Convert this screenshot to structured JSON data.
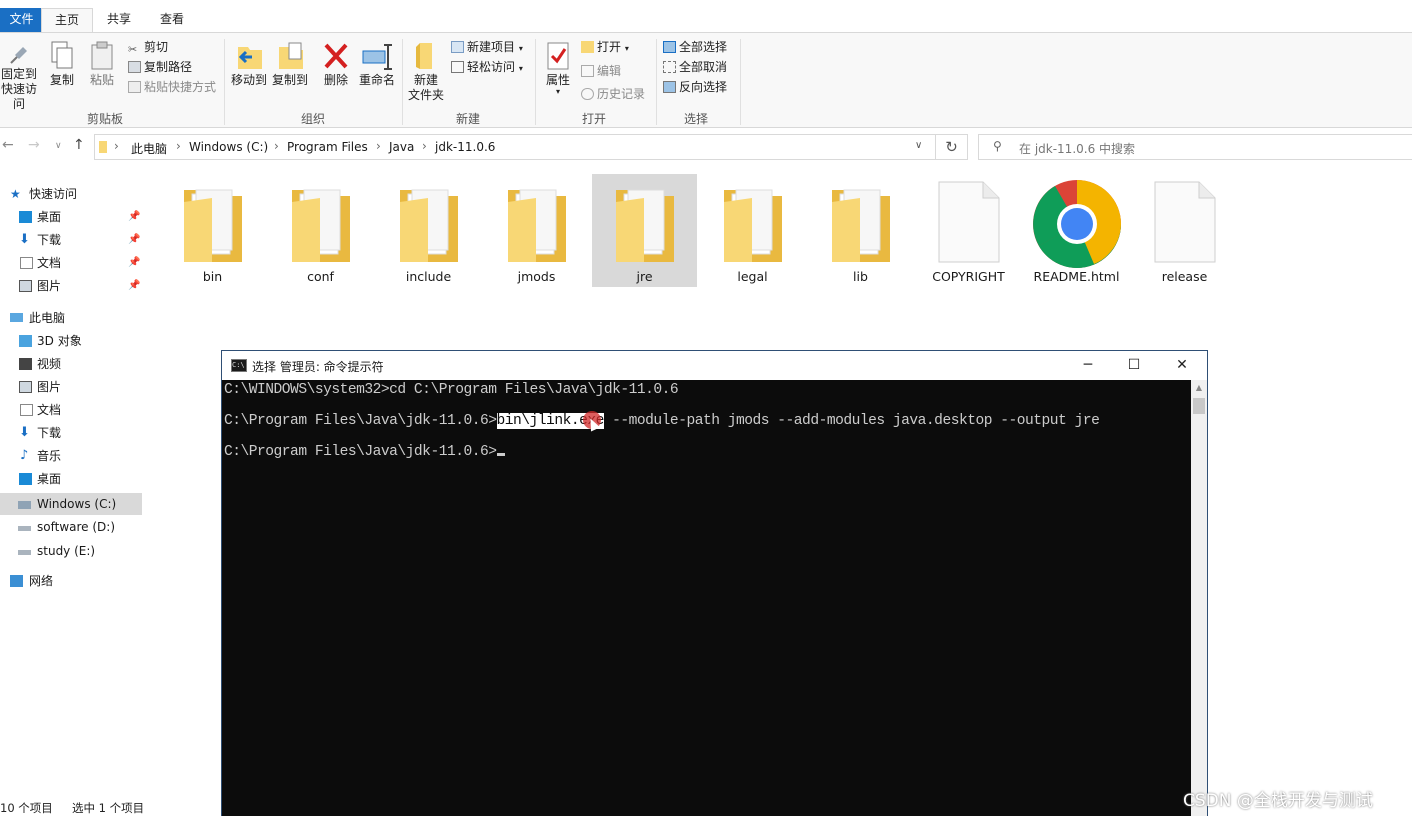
{
  "ribbon_tabs": {
    "file": "文件",
    "home": "主页",
    "share": "共享",
    "view": "查看"
  },
  "clipboard": {
    "pin": "固定到\n快速访问",
    "copy": "复制",
    "paste": "粘贴",
    "cut": "剪切",
    "copy_path": "复制路径",
    "paste_shortcut": "粘贴快捷方式",
    "label": "剪贴板"
  },
  "organize": {
    "move_to": "移动到",
    "copy_to": "复制到",
    "delete": "删除",
    "rename": "重命名",
    "label": "组织"
  },
  "new_group": {
    "new_folder": "新建\n文件夹",
    "new_item": "新建项目",
    "easy_access": "轻松访问",
    "label": "新建"
  },
  "open_group": {
    "properties": "属性",
    "open": "打开",
    "edit": "编辑",
    "history": "历史记录",
    "label": "打开"
  },
  "select_group": {
    "select_all": "全部选择",
    "select_none": "全部取消",
    "invert": "反向选择",
    "label": "选择"
  },
  "address": {
    "crumbs": [
      "此电脑",
      "Windows (C:)",
      "Program Files",
      "Java",
      "jdk-11.0.6"
    ],
    "search_placeholder": "在 jdk-11.0.6 中搜索"
  },
  "sidebar": {
    "quick_access": "快速访问",
    "quick_items": [
      "桌面",
      "下载",
      "文档",
      "图片"
    ],
    "this_pc": "此电脑",
    "pc_items": [
      "3D 对象",
      "视频",
      "图片",
      "文档",
      "下载",
      "音乐",
      "桌面",
      "Windows (C:)",
      "software (D:)",
      "study (E:)"
    ],
    "network": "网络"
  },
  "files": [
    {
      "name": "bin",
      "type": "folder"
    },
    {
      "name": "conf",
      "type": "folder"
    },
    {
      "name": "include",
      "type": "folder"
    },
    {
      "name": "jmods",
      "type": "folder"
    },
    {
      "name": "jre",
      "type": "folder",
      "selected": true
    },
    {
      "name": "legal",
      "type": "folder"
    },
    {
      "name": "lib",
      "type": "folder"
    },
    {
      "name": "COPYRIGHT",
      "type": "file"
    },
    {
      "name": "README.html",
      "type": "chrome-html"
    },
    {
      "name": "release",
      "type": "file"
    }
  ],
  "status": {
    "count": "10 个项目",
    "selected": "选中 1 个项目"
  },
  "cmd": {
    "title": "选择 管理员: 命令提示符",
    "line1": "C:\\WINDOWS\\system32>cd C:\\Program Files\\Java\\jdk-11.0.6",
    "line2_prompt": "C:\\Program Files\\Java\\jdk-11.0.6>",
    "line2_selected": "bin\\jlink.exe",
    "line2_rest": " --module-path jmods --add-modules java.desktop --output jre",
    "line3_prompt": "C:\\Program Files\\Java\\jdk-11.0.6>"
  },
  "watermark": "CSDN @全栈开发与测试",
  "colors": {
    "accent": "#1a6fc4",
    "folder": "#f8d775",
    "cmd_bg": "#0c0c0c",
    "cmd_fg": "#cccccc",
    "selection": "#d9d9d9"
  }
}
